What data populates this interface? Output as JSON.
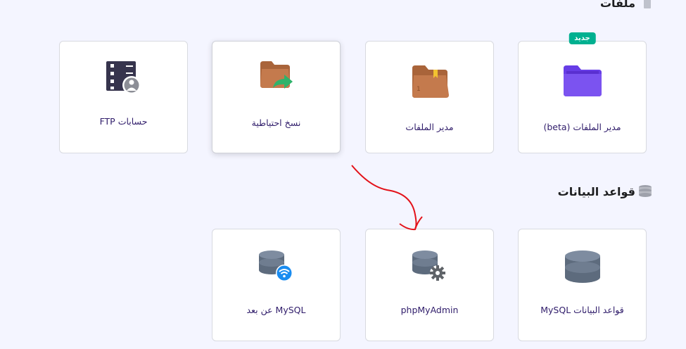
{
  "files_section": {
    "title": "ملفات",
    "cards": [
      {
        "label": "مدير الملفات (beta)",
        "badge": "جديد",
        "icon": "purple-folder-icon"
      },
      {
        "label": "مدير الملفات",
        "icon": "brown-folder-bookmark-icon"
      },
      {
        "label": "نسخ احتياطية",
        "icon": "folder-share-arrow-icon"
      },
      {
        "label": "حسابات FTP",
        "icon": "ftp-server-user-icon"
      }
    ]
  },
  "databases_section": {
    "title": "قواعد البيانات",
    "cards": [
      {
        "label": "قواعد البيانات MySQL",
        "icon": "database-icon"
      },
      {
        "label": "phpMyAdmin",
        "icon": "database-gear-icon"
      },
      {
        "label": "MySQL عن بعد",
        "icon": "database-wifi-icon"
      }
    ]
  },
  "colors": {
    "page_background": "#f4f5ff",
    "badge_green": "#00b090",
    "annotation_red": "#e3121a",
    "purple_folder": "#673de6",
    "brown_folder": "#c47a4d"
  }
}
